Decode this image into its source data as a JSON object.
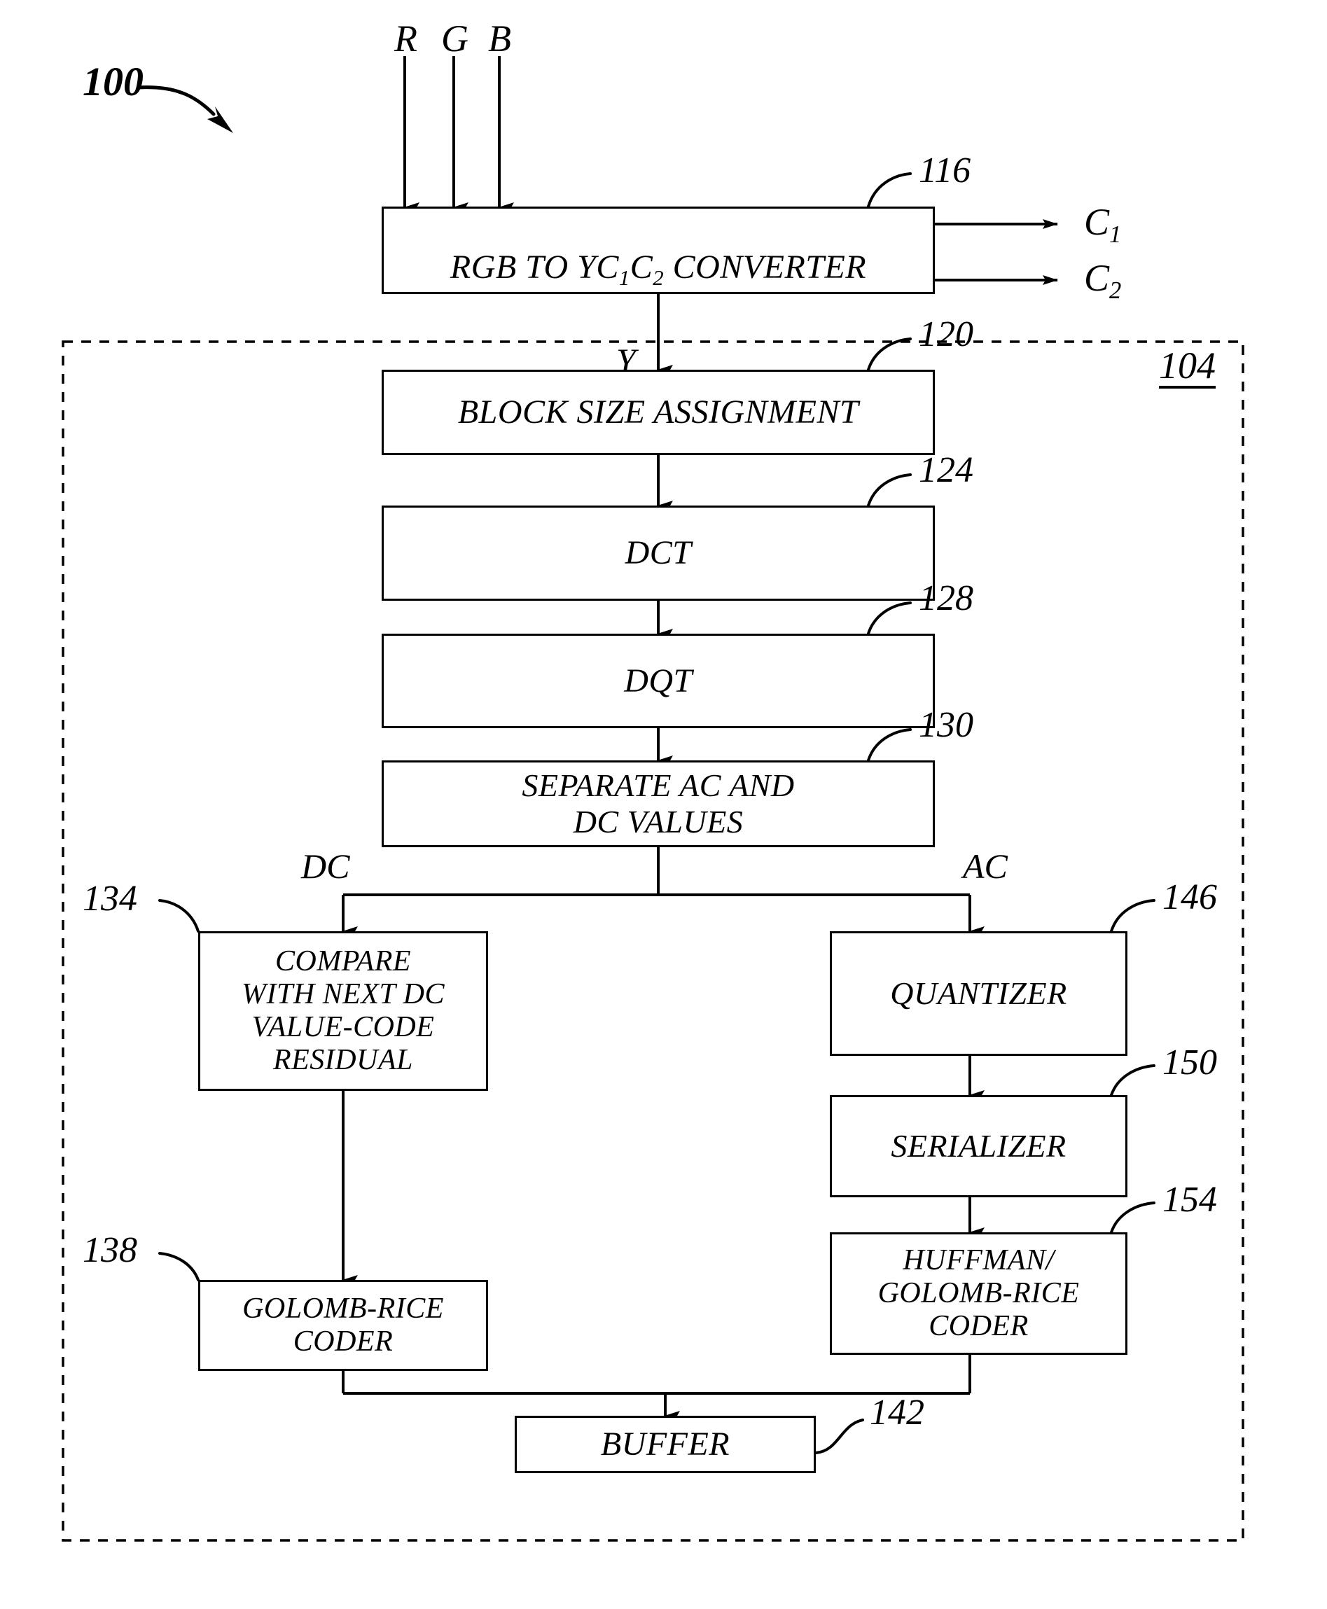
{
  "figure": {
    "diagram_label": "100",
    "subsystem_label": "104"
  },
  "inputs": [
    {
      "name": "R",
      "label": "R"
    },
    {
      "name": "G",
      "label": "G"
    },
    {
      "name": "B",
      "label": "B"
    }
  ],
  "outputs": [
    {
      "name": "C1",
      "base": "C",
      "sub": "1"
    },
    {
      "name": "C2",
      "base": "C",
      "sub": "2"
    }
  ],
  "signals": {
    "luma": "Y",
    "dc": "DC",
    "ac": "AC"
  },
  "blocks": {
    "converter": {
      "label_base": "RGB TO YC",
      "sub1": "1",
      "mid": "C",
      "sub2": "2",
      "tail": " CONVERTER",
      "ref": "116"
    },
    "block_size_assignment": {
      "label": "BLOCK SIZE ASSIGNMENT",
      "ref": "120"
    },
    "dct": {
      "label": "DCT",
      "ref": "124"
    },
    "dqt": {
      "label": "DQT",
      "ref": "128"
    },
    "separate": {
      "label": "SEPARATE AC AND\nDC VALUES",
      "ref": "130"
    },
    "compare_dc": {
      "label": "COMPARE\nWITH NEXT DC\nVALUE-CODE\nRESIDUAL",
      "ref": "134"
    },
    "golomb_rice_coder": {
      "label": "GOLOMB-RICE\nCODER",
      "ref": "138"
    },
    "quantizer": {
      "label": "QUANTIZER",
      "ref": "146"
    },
    "serializer": {
      "label": "SERIALIZER",
      "ref": "150"
    },
    "huffman_golomb_rice_coder": {
      "label": "HUFFMAN/\nGOLOMB-RICE\nCODER",
      "ref": "154"
    },
    "buffer": {
      "label": "BUFFER",
      "ref": "142"
    }
  },
  "colors": {
    "line": "#000000",
    "background": "#ffffff"
  }
}
